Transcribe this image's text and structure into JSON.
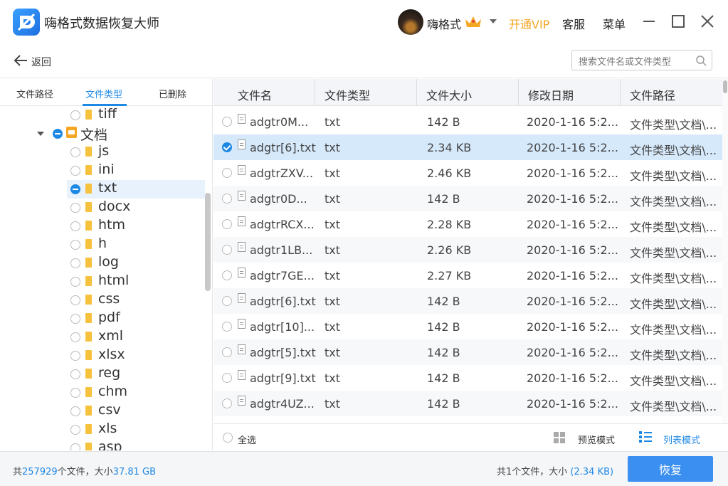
{
  "app": {
    "title": "嗨格式数据恢复大师"
  },
  "user": {
    "name": "嗨格式",
    "vip_link": "开通VIP",
    "service": "客服",
    "menu": "菜单"
  },
  "colors": {
    "accent": "#1e88e5",
    "vip": "#f5a623",
    "primary_button": "#3a8ff0"
  },
  "nav": {
    "back_label": "返回",
    "search_placeholder": "搜索文件名或文件类型"
  },
  "left_tabs": [
    {
      "label": "文件路径",
      "active": false
    },
    {
      "label": "文件类型",
      "active": true
    },
    {
      "label": "已删除",
      "active": false
    }
  ],
  "tree": [
    {
      "label": "tiff",
      "level": 2,
      "state": "unchecked"
    },
    {
      "label": "文档",
      "level": 1,
      "state": "partial",
      "expanded": true
    },
    {
      "label": "js",
      "level": 2,
      "state": "unchecked"
    },
    {
      "label": "ini",
      "level": 2,
      "state": "unchecked"
    },
    {
      "label": "txt",
      "level": 2,
      "state": "partial",
      "selected": true
    },
    {
      "label": "docx",
      "level": 2,
      "state": "unchecked"
    },
    {
      "label": "htm",
      "level": 2,
      "state": "unchecked"
    },
    {
      "label": "h",
      "level": 2,
      "state": "unchecked"
    },
    {
      "label": "log",
      "level": 2,
      "state": "unchecked"
    },
    {
      "label": "html",
      "level": 2,
      "state": "unchecked"
    },
    {
      "label": "css",
      "level": 2,
      "state": "unchecked"
    },
    {
      "label": "pdf",
      "level": 2,
      "state": "unchecked"
    },
    {
      "label": "xml",
      "level": 2,
      "state": "unchecked"
    },
    {
      "label": "xlsx",
      "level": 2,
      "state": "unchecked"
    },
    {
      "label": "reg",
      "level": 2,
      "state": "unchecked"
    },
    {
      "label": "chm",
      "level": 2,
      "state": "unchecked"
    },
    {
      "label": "csv",
      "level": 2,
      "state": "unchecked"
    },
    {
      "label": "xls",
      "level": 2,
      "state": "unchecked"
    },
    {
      "label": "asp",
      "level": 2,
      "state": "unchecked"
    }
  ],
  "table": {
    "columns": [
      "文件名",
      "文件类型",
      "文件大小",
      "修改日期",
      "文件路径"
    ],
    "rows": [
      {
        "name": "adgtr0M...",
        "type": "txt",
        "size": "142 B",
        "date": "2020-1-16 5:2...",
        "path": "文件类型\\文档\\...",
        "checked": false
      },
      {
        "name": "adgtr[6].txt",
        "type": "txt",
        "size": "2.34 KB",
        "date": "2020-1-16 5:2...",
        "path": "文件类型\\文档\\...",
        "checked": true
      },
      {
        "name": "adgtrZXV...",
        "type": "txt",
        "size": "2.46 KB",
        "date": "2020-1-16 5:2...",
        "path": "文件类型\\文档\\...",
        "checked": false
      },
      {
        "name": "adgtr0D...",
        "type": "txt",
        "size": "142 B",
        "date": "2020-1-16 5:2...",
        "path": "文件类型\\文档\\...",
        "checked": false
      },
      {
        "name": "adgtrRCX...",
        "type": "txt",
        "size": "2.28 KB",
        "date": "2020-1-16 5:2...",
        "path": "文件类型\\文档\\...",
        "checked": false
      },
      {
        "name": "adgtr1LB...",
        "type": "txt",
        "size": "2.26 KB",
        "date": "2020-1-16 5:2...",
        "path": "文件类型\\文档\\...",
        "checked": false
      },
      {
        "name": "adgtr7GE...",
        "type": "txt",
        "size": "2.27 KB",
        "date": "2020-1-16 5:2...",
        "path": "文件类型\\文档\\...",
        "checked": false
      },
      {
        "name": "adgtr[6].txt",
        "type": "txt",
        "size": "142 B",
        "date": "2020-1-16 5:2...",
        "path": "文件类型\\文档\\...",
        "checked": false
      },
      {
        "name": "adgtr[10]...",
        "type": "txt",
        "size": "142 B",
        "date": "2020-1-16 5:2...",
        "path": "文件类型\\文档\\...",
        "checked": false
      },
      {
        "name": "adgtr[5].txt",
        "type": "txt",
        "size": "142 B",
        "date": "2020-1-16 5:2...",
        "path": "文件类型\\文档\\...",
        "checked": false
      },
      {
        "name": "adgtr[9].txt",
        "type": "txt",
        "size": "142 B",
        "date": "2020-1-16 5:2...",
        "path": "文件类型\\文档\\...",
        "checked": false
      },
      {
        "name": "adgtr4UZ...",
        "type": "txt",
        "size": "142 B",
        "date": "2020-1-16 5:2...",
        "path": "文件类型\\文档\\...",
        "checked": false
      }
    ]
  },
  "bottom": {
    "select_all": "全选",
    "preview_mode": "预览模式",
    "list_mode": "列表模式",
    "active_mode": "list"
  },
  "status": {
    "prefix": "共",
    "file_count": "257929",
    "middle": "个文件，大小",
    "total_size": "37.81 GB",
    "selected_prefix": "共1个文件，大小",
    "selected_size": "(2.34 KB)"
  },
  "recover_button": "恢复"
}
